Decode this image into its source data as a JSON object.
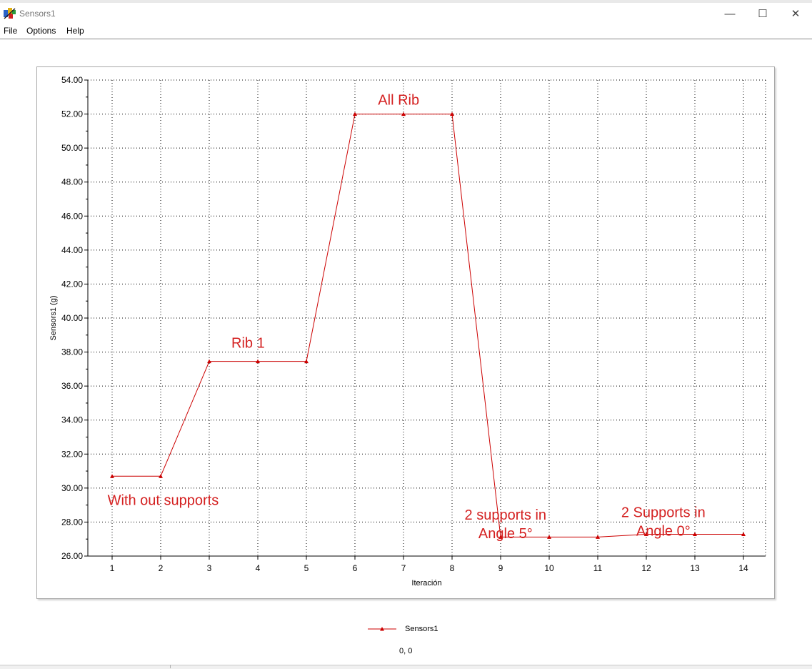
{
  "window": {
    "title": "Sensors1",
    "minimize_glyph": "—",
    "maximize_glyph": "☐",
    "close_glyph": "✕",
    "app_icon": "sensor-app-icon"
  },
  "menu": {
    "items": [
      "File",
      "Options",
      "Help"
    ]
  },
  "chart_data": {
    "type": "line",
    "x": [
      1,
      2,
      3,
      4,
      5,
      6,
      7,
      8,
      9,
      10,
      11,
      12,
      13,
      14
    ],
    "series": [
      {
        "name": "Sensors1",
        "color": "#cc0000",
        "marker": "triangle",
        "values": [
          30.7,
          30.7,
          37.45,
          37.45,
          37.45,
          52.0,
          52.0,
          52.0,
          27.12,
          27.12,
          27.12,
          27.28,
          27.28,
          27.28
        ]
      }
    ],
    "xlabel": "Iteración",
    "ylabel": "Sensors1 (g)",
    "ylim": [
      26,
      54
    ],
    "yticks": [
      26,
      28,
      30,
      32,
      34,
      36,
      38,
      40,
      42,
      44,
      46,
      48,
      50,
      52,
      54
    ],
    "ytick_labels": [
      "26.00",
      "28.00",
      "30.00",
      "32.00",
      "34.00",
      "36.00",
      "38.00",
      "40.00",
      "42.00",
      "44.00",
      "46.00",
      "48.00",
      "50.00",
      "52.00",
      "54.00"
    ],
    "xticks": [
      1,
      2,
      3,
      4,
      5,
      6,
      7,
      8,
      9,
      10,
      11,
      12,
      13,
      14
    ],
    "grid": true,
    "legend": "bottom",
    "annotations": [
      {
        "lines": [
          "With out supports"
        ],
        "x": 2.05,
        "y": 29.0,
        "color": "#d42020"
      },
      {
        "lines": [
          "Rib 1"
        ],
        "x": 3.8,
        "y": 38.25,
        "color": "#d42020"
      },
      {
        "lines": [
          "All Rib"
        ],
        "x": 6.9,
        "y": 52.55,
        "color": "#d42020"
      },
      {
        "lines": [
          "2 supports in",
          "Angle 5°"
        ],
        "x": 9.1,
        "y": 28.15,
        "color": "#d42020"
      },
      {
        "lines": [
          "2 Supports in",
          "Angle 0°"
        ],
        "x": 12.35,
        "y": 28.3,
        "color": "#d42020"
      }
    ]
  },
  "legend": {
    "label": "Sensors1"
  },
  "status": {
    "coords": "0, 0"
  }
}
